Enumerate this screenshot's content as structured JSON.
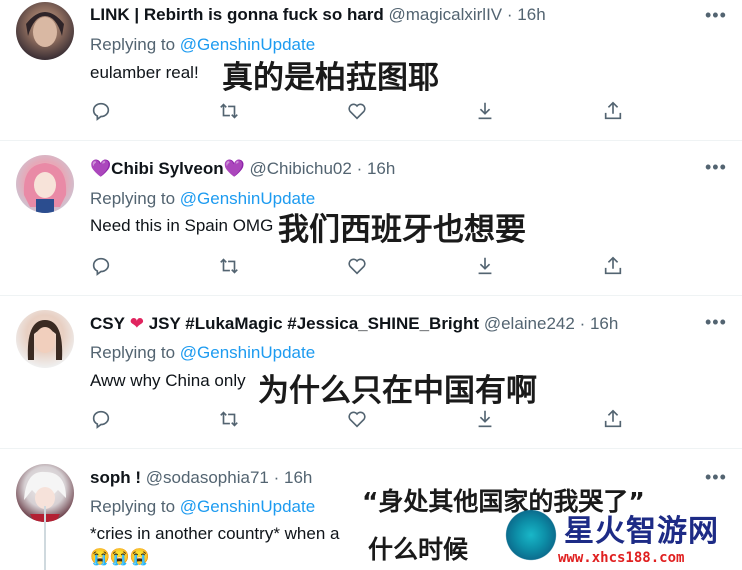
{
  "tweets": [
    {
      "name": "LINK | Rebirth is gonna fuck so hard",
      "handle": "@magicalxirlIV",
      "time": "16h",
      "replying_prefix": "Replying to",
      "replying_to": "@GenshinUpdate",
      "body": "eulamber real!",
      "overlay": "真的是柏菈图耶"
    },
    {
      "name_prefix_emoji": "💜",
      "name": "Chibi Sylveon",
      "name_suffix_emoji": "💜",
      "handle": "@Chibichu02",
      "time": "16h",
      "replying_prefix": "Replying to",
      "replying_to": "@GenshinUpdate",
      "body": "Need this in Spain OMG",
      "overlay": "我们西班牙也想要"
    },
    {
      "name_part1": "CSY",
      "name_heart": "❤",
      "name_part2": "JSY #LukaMagic #Jessica_SHINE_Bright",
      "handle": "@elaine242",
      "time": "16h",
      "replying_prefix": "Replying to",
      "replying_to": "@GenshinUpdate",
      "body": "Aww why China only",
      "overlay": "为什么只在中国有啊"
    },
    {
      "name": "soph !",
      "handle": "@sodasophia71",
      "time": "16h",
      "replying_prefix": "Replying to",
      "replying_to": "@GenshinUpdate",
      "body": "*cries in another country* when a",
      "emojis": "😭😭😭",
      "overlay_line1": "“身处其他国家的我哭了”",
      "overlay_line2": "什么时候"
    }
  ],
  "more_label": "•••",
  "separator": "·",
  "icons": [
    "reply-icon",
    "retweet-icon",
    "like-icon",
    "download-icon",
    "share-icon"
  ],
  "watermark": {
    "title": "星火智游网",
    "url": "www.xhcs188.com"
  },
  "colors": {
    "link": "#1d9bf0",
    "secondary_text": "#536471",
    "primary_text": "#0f1419",
    "watermark_title": "#1d2b86",
    "watermark_url": "#e02020"
  }
}
